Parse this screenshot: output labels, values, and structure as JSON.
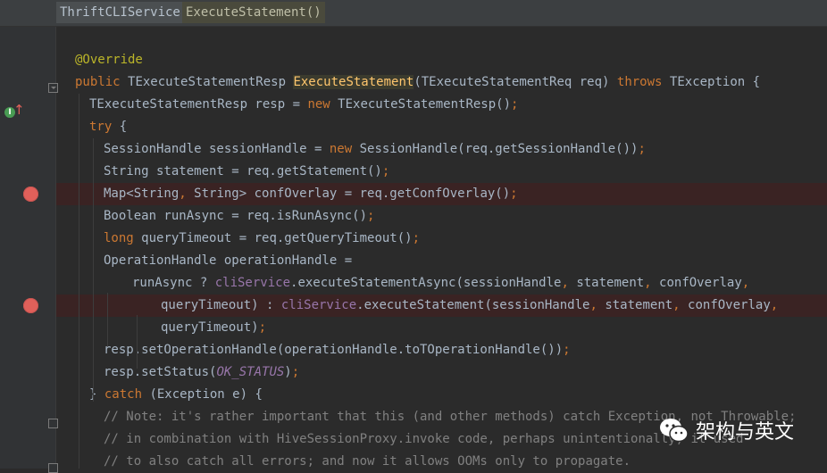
{
  "breadcrumbs": [
    "ThriftCLIService",
    "ExecuteStatement()"
  ],
  "gutter": {
    "implements_icon": "implements-method-icon",
    "breakpoint_icon": "breakpoint-icon",
    "fold_icon": "fold-marker-icon"
  },
  "code_lines": [
    {
      "indent": 0,
      "tokens": []
    },
    {
      "indent": 1,
      "tokens": [
        {
          "t": "@Override",
          "c": "ann"
        }
      ]
    },
    {
      "indent": 1,
      "tokens": [
        {
          "t": "public ",
          "c": "kw"
        },
        {
          "t": "TExecuteStatementResp "
        },
        {
          "t": "ExecuteStatement",
          "c": "hl"
        },
        {
          "t": "(TExecuteStatementReq req) "
        },
        {
          "t": "throws ",
          "c": "kw"
        },
        {
          "t": "TException {"
        }
      ]
    },
    {
      "indent": 2,
      "tokens": [
        {
          "t": "TExecuteStatementResp resp = "
        },
        {
          "t": "new ",
          "c": "kw"
        },
        {
          "t": "TExecuteStatementResp()"
        },
        {
          "t": ";",
          "c": "kw"
        }
      ]
    },
    {
      "indent": 2,
      "tokens": [
        {
          "t": "try ",
          "c": "kw"
        },
        {
          "t": "{"
        }
      ]
    },
    {
      "indent": 3,
      "tokens": [
        {
          "t": "SessionHandle sessionHandle = "
        },
        {
          "t": "new ",
          "c": "kw"
        },
        {
          "t": "SessionHandle(req.getSessionHandle())"
        },
        {
          "t": ";",
          "c": "kw"
        }
      ]
    },
    {
      "indent": 3,
      "tokens": [
        {
          "t": "String statement = req.getStatement()"
        },
        {
          "t": ";",
          "c": "kw"
        }
      ]
    },
    {
      "indent": 3,
      "breakpoint": true,
      "tokens": [
        {
          "t": "Map<String"
        },
        {
          "t": ", ",
          "c": "kw"
        },
        {
          "t": "String> confOverlay = req.getConfOverlay()"
        },
        {
          "t": ";",
          "c": "kw"
        }
      ]
    },
    {
      "indent": 3,
      "tokens": [
        {
          "t": "Boolean runAsync = req.isRunAsync()"
        },
        {
          "t": ";",
          "c": "kw"
        }
      ]
    },
    {
      "indent": 3,
      "tokens": [
        {
          "t": "long ",
          "c": "kw"
        },
        {
          "t": "queryTimeout = req.getQueryTimeout()"
        },
        {
          "t": ";",
          "c": "kw"
        }
      ]
    },
    {
      "indent": 3,
      "tokens": [
        {
          "t": "OperationHandle operationHandle ="
        }
      ]
    },
    {
      "indent": 5,
      "tokens": [
        {
          "t": "runAsync ? "
        },
        {
          "t": "cliService",
          "c": "fld"
        },
        {
          "t": ".executeStatementAsync(sessionHandle"
        },
        {
          "t": ", ",
          "c": "kw"
        },
        {
          "t": "statement"
        },
        {
          "t": ", ",
          "c": "kw"
        },
        {
          "t": "confOverlay"
        },
        {
          "t": ",",
          "c": "kw"
        }
      ]
    },
    {
      "indent": 7,
      "breakpoint": true,
      "tokens": [
        {
          "t": "queryTimeout) : "
        },
        {
          "t": "cliService",
          "c": "fld"
        },
        {
          "t": ".executeStatement(sessionHandle"
        },
        {
          "t": ", ",
          "c": "kw"
        },
        {
          "t": "statement"
        },
        {
          "t": ", ",
          "c": "kw"
        },
        {
          "t": "confOverlay"
        },
        {
          "t": ",",
          "c": "kw"
        }
      ]
    },
    {
      "indent": 7,
      "tokens": [
        {
          "t": "queryTimeout)"
        },
        {
          "t": ";",
          "c": "kw"
        }
      ]
    },
    {
      "indent": 3,
      "tokens": [
        {
          "t": "resp.setOperationHandle(operationHandle.toTOperationHandle())"
        },
        {
          "t": ";",
          "c": "kw"
        }
      ]
    },
    {
      "indent": 3,
      "tokens": [
        {
          "t": "resp.setStatus("
        },
        {
          "t": "OK_STATUS",
          "c": "cst"
        },
        {
          "t": ")"
        },
        {
          "t": ";",
          "c": "kw"
        }
      ]
    },
    {
      "indent": 2,
      "tokens": [
        {
          "t": "} "
        },
        {
          "t": "catch ",
          "c": "kw"
        },
        {
          "t": "(Exception e) {"
        }
      ]
    },
    {
      "indent": 3,
      "tokens": [
        {
          "t": "// Note: it's rather important that this (and other methods) catch Exception, not Throwable;",
          "c": "cm"
        }
      ]
    },
    {
      "indent": 3,
      "tokens": [
        {
          "t": "// in combination with HiveSessionProxy.invoke code, perhaps unintentionally, it used",
          "c": "cm"
        }
      ]
    },
    {
      "indent": 3,
      "tokens": [
        {
          "t": "// to also catch all errors; and now it allows OOMs only to propagate.",
          "c": "cm"
        }
      ]
    }
  ],
  "watermark": {
    "text": "架构与英文",
    "icon": "wechat-icon"
  }
}
